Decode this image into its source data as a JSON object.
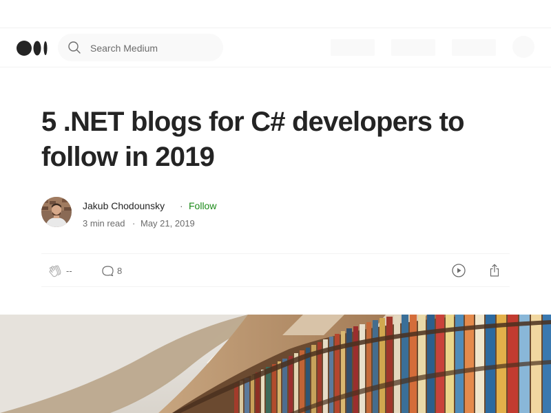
{
  "header": {
    "search_placeholder": "Search Medium"
  },
  "article": {
    "title": "5 .NET blogs for C# developers to follow in 2019",
    "author_name": "Jakub Chodounsky",
    "follow_label": "Follow",
    "read_time": "3 min read",
    "date": "May 21, 2019",
    "separator": "·"
  },
  "actions": {
    "clap_count": "--",
    "response_count": "8"
  },
  "colors": {
    "follow": "#1a8917",
    "text": "#242424",
    "muted": "#6b6b6b"
  }
}
